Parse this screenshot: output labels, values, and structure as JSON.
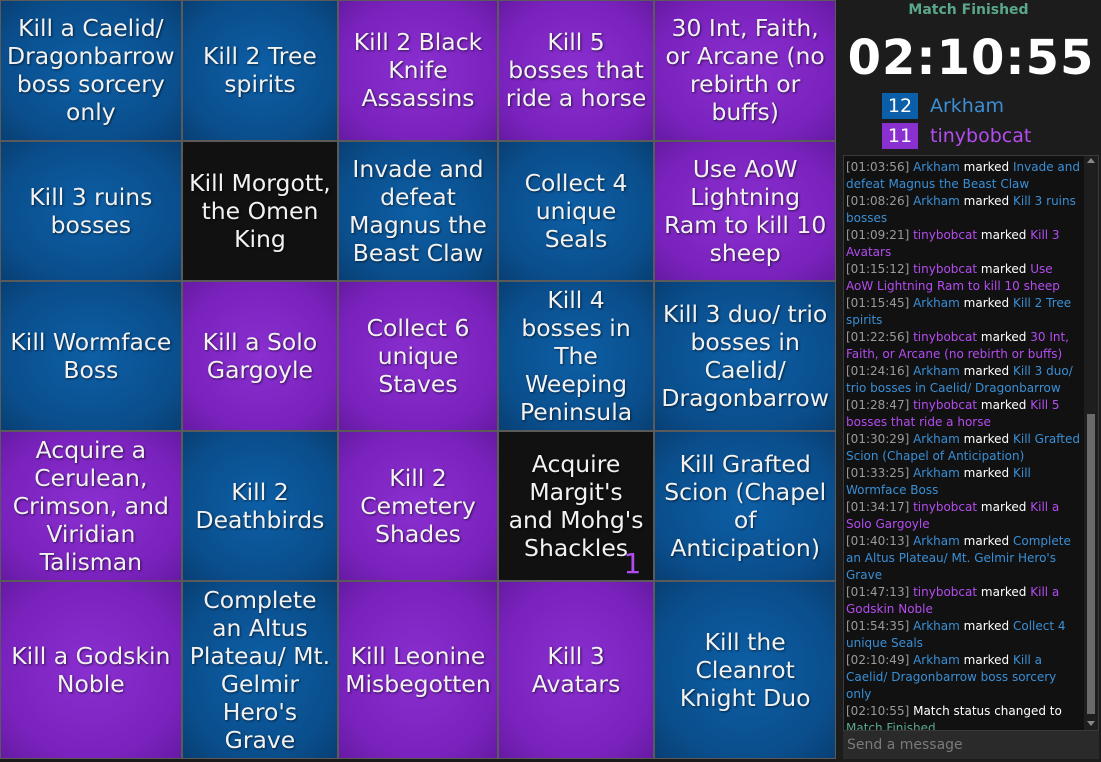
{
  "board": {
    "cells": [
      {
        "text": "Kill a Caelid/ Dragonbarrow boss sorcery only",
        "color": "blue"
      },
      {
        "text": "Kill 2 Tree spirits",
        "color": "blue"
      },
      {
        "text": "Kill 2 Black Knife Assassins",
        "color": "purple"
      },
      {
        "text": "Kill 5 bosses that ride a horse",
        "color": "purple"
      },
      {
        "text": "30 Int, Faith, or Arcane (no rebirth or buffs)",
        "color": "purple"
      },
      {
        "text": "Kill 3 ruins bosses",
        "color": "blue"
      },
      {
        "text": "Kill Morgott, the Omen King",
        "color": "black"
      },
      {
        "text": "Invade and defeat Magnus the Beast Claw",
        "color": "blue"
      },
      {
        "text": "Collect 4 unique Seals",
        "color": "blue"
      },
      {
        "text": "Use AoW Lightning Ram to kill 10 sheep",
        "color": "purple"
      },
      {
        "text": "Kill Wormface Boss",
        "color": "blue"
      },
      {
        "text": "Kill a Solo Gargoyle",
        "color": "purple"
      },
      {
        "text": "Collect 6 unique Staves",
        "color": "purple"
      },
      {
        "text": "Kill 4 bosses in The Weeping Peninsula",
        "color": "blue"
      },
      {
        "text": "Kill 3 duo/ trio bosses in Caelid/ Dragonbarrow",
        "color": "blue"
      },
      {
        "text": "Acquire a Cerulean, Crimson, and Viridian Talisman",
        "color": "purple"
      },
      {
        "text": "Kill 2 Deathbirds",
        "color": "blue"
      },
      {
        "text": "Kill 2 Cemetery Shades",
        "color": "purple"
      },
      {
        "text": "Acquire Margit's and Mohg's Shackles",
        "color": "black",
        "counter": "1"
      },
      {
        "text": "Kill Grafted Scion (Chapel of Anticipation)",
        "color": "blue"
      },
      {
        "text": "Kill a Godskin Noble",
        "color": "purple"
      },
      {
        "text": "Complete an Altus Plateau/ Mt. Gelmir Hero's Grave",
        "color": "blue"
      },
      {
        "text": "Kill Leonine Misbegotten",
        "color": "purple"
      },
      {
        "text": "Kill 3 Avatars",
        "color": "purple"
      },
      {
        "text": "Kill the Cleanrot Knight Duo",
        "color": "blue"
      }
    ]
  },
  "panel": {
    "status": "Match Finished",
    "timer": "02:10:55",
    "players": [
      {
        "score": "12",
        "name": "Arkham",
        "color": "#0a5fa8"
      },
      {
        "score": "11",
        "name": "tinybobcat",
        "color": "#8a2fd0"
      }
    ]
  },
  "log": [
    {
      "time": "[01:03:56]",
      "who": "Arkham",
      "who_color": "blue",
      "action": "marked",
      "goal": "Invade and defeat Magnus the Beast Claw"
    },
    {
      "time": "[01:08:26]",
      "who": "Arkham",
      "who_color": "blue",
      "action": "marked",
      "goal": "Kill 3 ruins bosses"
    },
    {
      "time": "[01:09:21]",
      "who": "tinybobcat",
      "who_color": "purple",
      "action": "marked",
      "goal": "Kill 3 Avatars"
    },
    {
      "time": "[01:15:12]",
      "who": "tinybobcat",
      "who_color": "purple",
      "action": "marked",
      "goal": "Use AoW Lightning Ram to kill 10 sheep"
    },
    {
      "time": "[01:15:45]",
      "who": "Arkham",
      "who_color": "blue",
      "action": "marked",
      "goal": "Kill 2 Tree spirits"
    },
    {
      "time": "[01:22:56]",
      "who": "tinybobcat",
      "who_color": "purple",
      "action": "marked",
      "goal": "30 Int, Faith, or Arcane (no rebirth or buffs)"
    },
    {
      "time": "[01:24:16]",
      "who": "Arkham",
      "who_color": "blue",
      "action": "marked",
      "goal": "Kill 3 duo/ trio bosses in Caelid/ Dragonbarrow"
    },
    {
      "time": "[01:28:47]",
      "who": "tinybobcat",
      "who_color": "purple",
      "action": "marked",
      "goal": "Kill 5 bosses that ride a horse"
    },
    {
      "time": "[01:30:29]",
      "who": "Arkham",
      "who_color": "blue",
      "action": "marked",
      "goal": "Kill Grafted Scion (Chapel of Anticipation)"
    },
    {
      "time": "[01:33:25]",
      "who": "Arkham",
      "who_color": "blue",
      "action": "marked",
      "goal": "Kill Wormface Boss"
    },
    {
      "time": "[01:34:17]",
      "who": "tinybobcat",
      "who_color": "purple",
      "action": "marked",
      "goal": "Kill a Solo Gargoyle"
    },
    {
      "time": "[01:40:13]",
      "who": "Arkham",
      "who_color": "blue",
      "action": "marked",
      "goal": "Complete an Altus Plateau/ Mt. Gelmir Hero's Grave"
    },
    {
      "time": "[01:47:13]",
      "who": "tinybobcat",
      "who_color": "purple",
      "action": "marked",
      "goal": "Kill a Godskin Noble"
    },
    {
      "time": "[01:54:35]",
      "who": "Arkham",
      "who_color": "blue",
      "action": "marked",
      "goal": "Collect 4 unique Seals"
    },
    {
      "time": "[02:10:49]",
      "who": "Arkham",
      "who_color": "blue",
      "action": "marked",
      "goal": "Kill a Caelid/ Dragonbarrow boss sorcery only"
    },
    {
      "time": "[02:10:55]",
      "who": "",
      "who_color": "",
      "action": "Match status changed to",
      "goal": "Match Finished",
      "goal_color": "green"
    }
  ],
  "chat": {
    "placeholder": "Send a message"
  }
}
